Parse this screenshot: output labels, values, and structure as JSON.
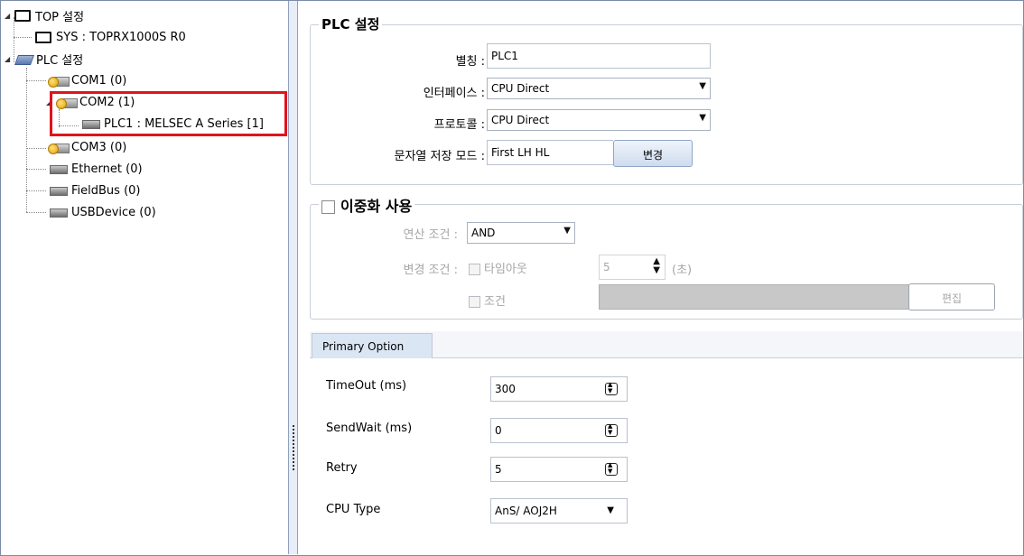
{
  "tree": {
    "items": [
      {
        "label": "TOP 설정"
      },
      {
        "label": "SYS : TOPRX1000S R0"
      },
      {
        "label": "PLC 설정"
      },
      {
        "label": "COM1 (0)"
      },
      {
        "label": "COM2 (1)"
      },
      {
        "label": "PLC1 : MELSEC A Series [1]"
      },
      {
        "label": "COM3 (0)"
      },
      {
        "label": "Ethernet (0)"
      },
      {
        "label": "FieldBus (0)"
      },
      {
        "label": "USBDevice (0)"
      }
    ]
  },
  "plc_settings": {
    "title": "PLC 설정",
    "alias_label": "별칭 :",
    "alias_value": "PLC1",
    "interface_label": "인터페이스 :",
    "interface_value": "CPU Direct",
    "protocol_label": "프로토콜 :",
    "protocol_value": "CPU Direct",
    "string_mode_label": "문자열 저장 모드 :",
    "string_mode_value": "First LH HL",
    "change_button": "변경"
  },
  "redundancy": {
    "title": "이중화 사용",
    "operation_label": "연산 조건 :",
    "operation_value": "AND",
    "change_label": "변경 조건 :",
    "timeout_check": "타임아웃",
    "timeout_value": "5",
    "timeout_unit": "(초)",
    "condition_check": "조건",
    "edit_button": "편집"
  },
  "primary_option": {
    "tab_label": "Primary Option",
    "rows": [
      {
        "label": "TimeOut (ms)",
        "value": "300"
      },
      {
        "label": "SendWait (ms)",
        "value": "0"
      },
      {
        "label": "Retry",
        "value": "5"
      }
    ],
    "cpu_type_label": "CPU Type",
    "cpu_type_value": "AnS/ AOJ2H"
  }
}
